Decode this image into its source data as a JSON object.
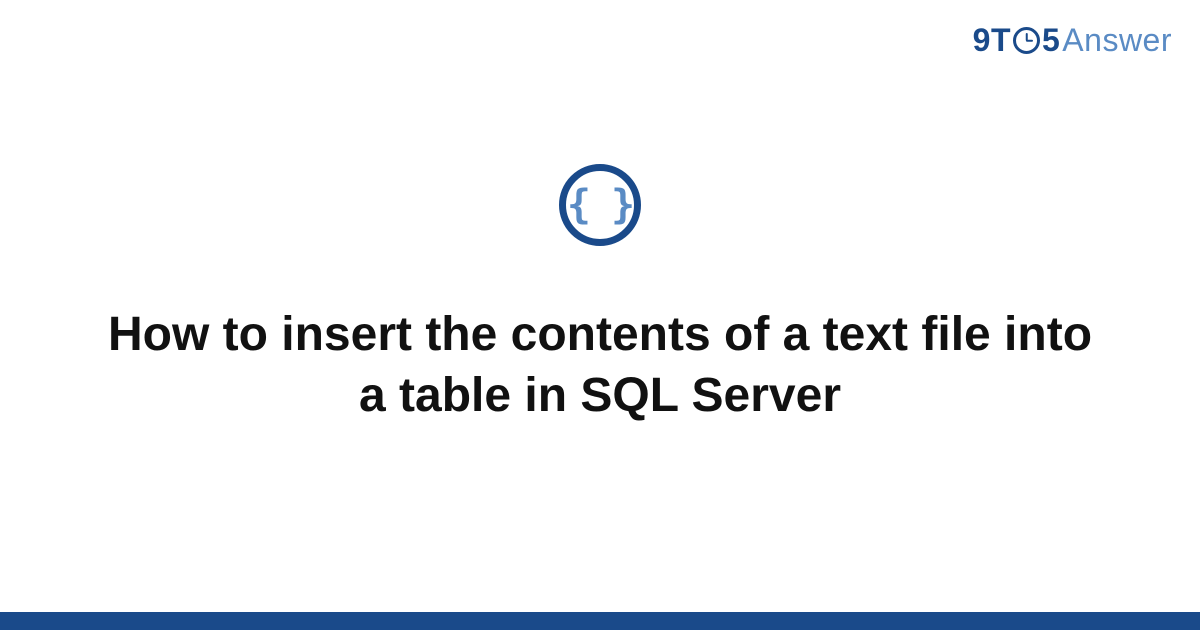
{
  "brand": {
    "part1": "9T",
    "part2": "5",
    "part3": "Answer"
  },
  "icon": {
    "name": "code-braces-icon",
    "glyph": "{ }"
  },
  "question": {
    "title": "How to insert the contents of a text file into a table in SQL Server"
  }
}
